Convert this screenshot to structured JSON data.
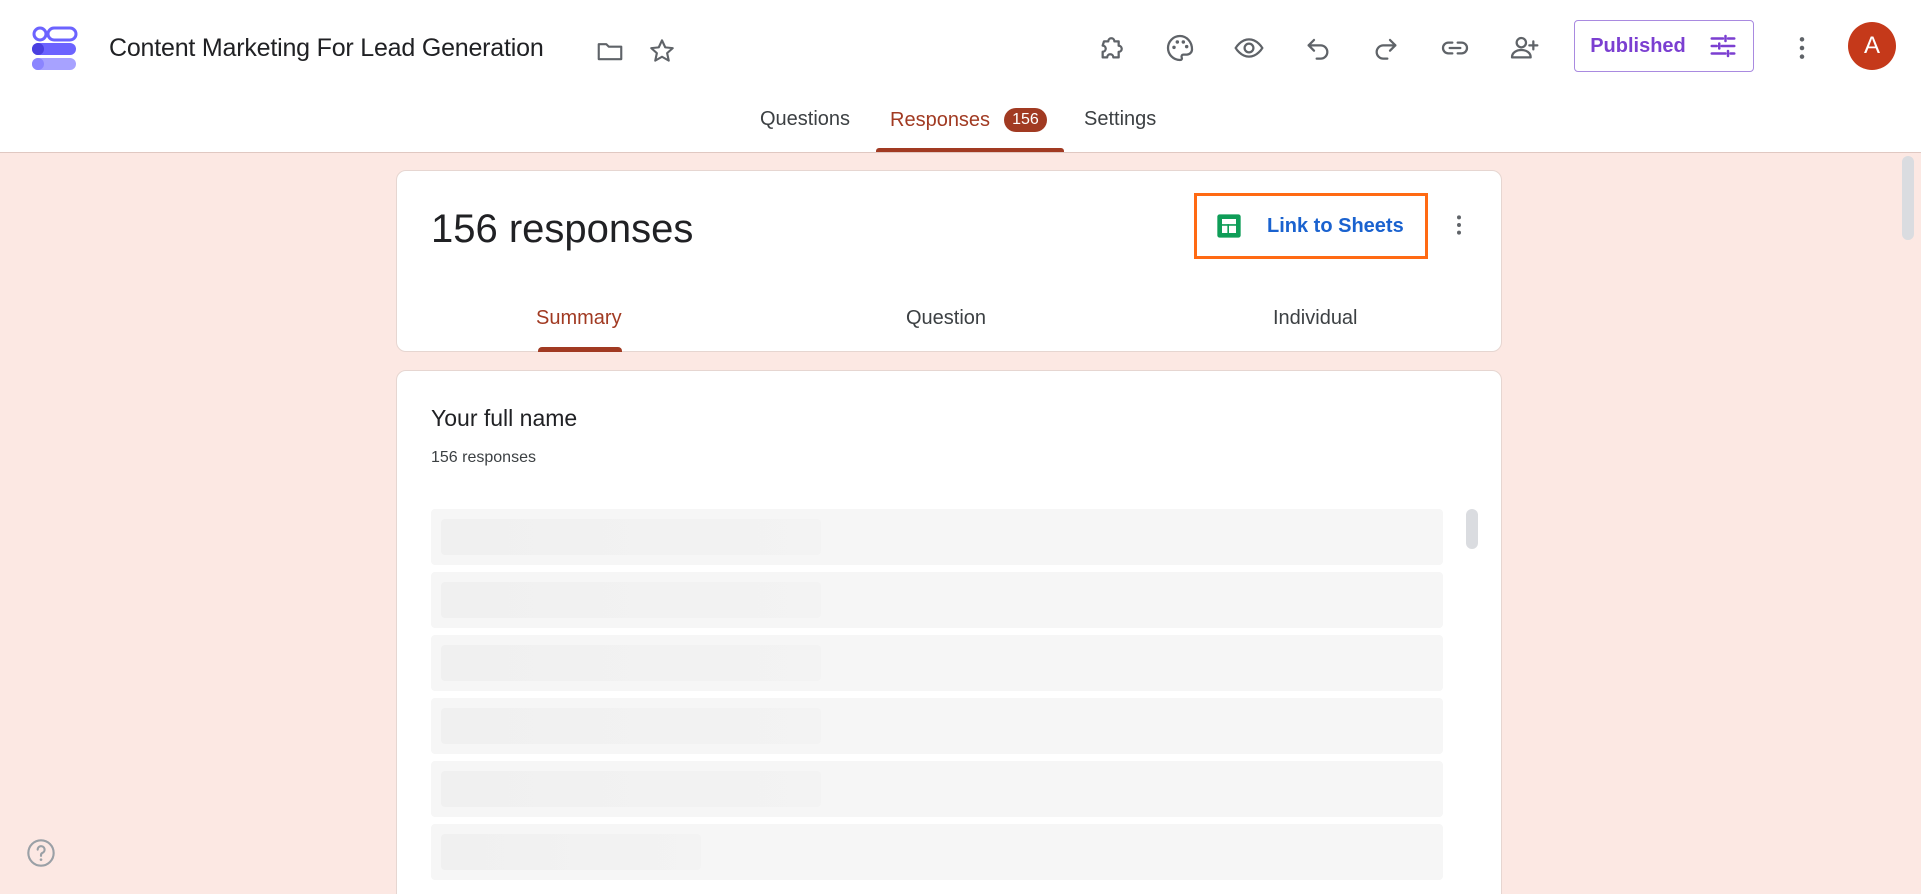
{
  "header": {
    "title": "Content Marketing For Lead Generation",
    "published_label": "Published",
    "avatar_initial": "A",
    "icons": [
      "folder-icon",
      "star-icon",
      "addons-icon",
      "palette-icon",
      "preview-icon",
      "undo-icon",
      "redo-icon",
      "link-icon",
      "add-collaborator-icon",
      "more-vert-icon"
    ]
  },
  "main_tabs": {
    "questions": "Questions",
    "responses": "Responses",
    "responses_badge": "156",
    "settings": "Settings"
  },
  "summary_card": {
    "count_text": "156 responses",
    "link_sheets_label": "Link to Sheets",
    "tabs": {
      "summary": "Summary",
      "question": "Question",
      "individual": "Individual"
    }
  },
  "question_card": {
    "title": "Your full name",
    "count_text": "156 responses"
  },
  "colors": {
    "accent": "#a13a22",
    "background": "#fce8e3",
    "published": "#7b3fd1",
    "link": "#1a62cf",
    "highlight": "#ff6a13",
    "sheets_green": "#0f9d58"
  }
}
